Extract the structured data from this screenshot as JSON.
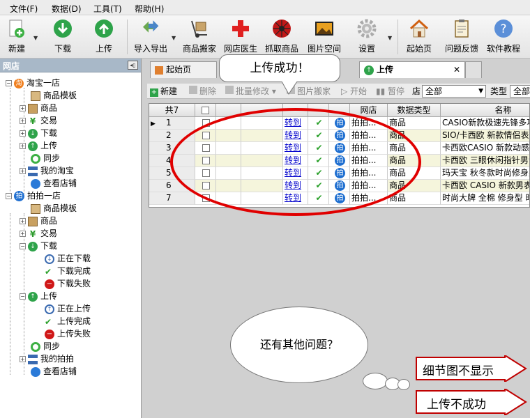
{
  "menu": [
    "文件(F)",
    "数据(D)",
    "工具(T)",
    "帮助(H)"
  ],
  "toolbar": {
    "new": "新建",
    "download": "下载",
    "upload": "上传",
    "import_export": "导入导出",
    "product_move": "商品搬家",
    "shop_doctor": "网店医生",
    "grab_product": "抓取商品",
    "image_space": "图片空间",
    "settings": "设置",
    "home": "起始页",
    "feedback": "问题反馈",
    "tutorial": "软件教程"
  },
  "sidebar": {
    "title": "网店",
    "shop1": {
      "name": "淘宝一店",
      "items": [
        "商品模板",
        "商品",
        "交易",
        "下载",
        "上传",
        "同步",
        "我的淘宝",
        "查看店铺"
      ]
    },
    "shop2": {
      "name": "拍拍一店",
      "items": [
        "商品模板",
        "商品",
        "交易",
        "下载",
        "上传",
        "同步",
        "我的拍拍",
        "查看店铺"
      ],
      "download_children": [
        "正在下载",
        "下载完成",
        "下载失败"
      ],
      "upload_children": [
        "正在上传",
        "上传完成",
        "上传失败"
      ]
    }
  },
  "tabs": {
    "home": "起始页",
    "upload": "上传"
  },
  "subtoolbar": {
    "new": "新建",
    "delete": "删除",
    "batch_edit": "批量修改",
    "image_move": "图片搬家",
    "start": "开始",
    "pause": "暂停",
    "filter_value": "全部",
    "type_label": "类型",
    "type_value": "全部",
    "shop_label_fragment": "店"
  },
  "grid": {
    "count_header": "共7",
    "headers": {
      "shop": "网店",
      "data_type": "数据类型",
      "name": "名称"
    },
    "rows": [
      {
        "n": "1",
        "link": "转到",
        "shop": "拍拍...",
        "type": "商品",
        "name": "CASIO新款极速先锋多功"
      },
      {
        "n": "2",
        "link": "转到",
        "shop": "拍拍...",
        "type": "商品",
        "name": "SIO/卡西欧 新款情侣表中"
      },
      {
        "n": "3",
        "link": "转到",
        "shop": "拍拍...",
        "type": "商品",
        "name": "卡西欧CASIO 新款动感时"
      },
      {
        "n": "4",
        "link": "转到",
        "shop": "拍拍...",
        "type": "商品",
        "name": "卡西欧 三眼休闲指针男士"
      },
      {
        "n": "5",
        "link": "转到",
        "shop": "拍拍...",
        "type": "商品",
        "name": "玛天宝 秋冬款时尚修身男"
      },
      {
        "n": "6",
        "link": "转到",
        "shop": "拍拍...",
        "type": "商品",
        "name": "卡西欧 CASIO 新款男表电"
      },
      {
        "n": "7",
        "link": "转到",
        "shop": "拍拍...",
        "type": "商品",
        "name": "时尚大牌 全棉 修身型 时"
      }
    ],
    "pai_glyph": "拍"
  },
  "callouts": {
    "upload_success": "上传成功！",
    "other_questions": "还有其他问题？",
    "detail_not_shown": "细节图不显示",
    "upload_failed": "上传不成功"
  },
  "colors": {
    "highlight_ellipse": "#e00000",
    "row_alt": "#f5f5dc",
    "link": "#0000cc",
    "pai_badge": "#1f6fd0"
  }
}
